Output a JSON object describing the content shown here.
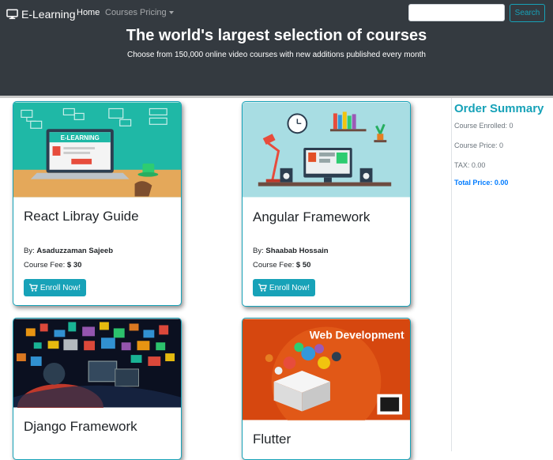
{
  "nav": {
    "brand": "E-Learning",
    "links": [
      "Home",
      "Courses",
      "Pricing"
    ],
    "search_button": "Search",
    "search_value": ""
  },
  "hero": {
    "title": "The world's largest selection of courses",
    "subtitle": "Choose from 150,000 online video courses with new additions published every month"
  },
  "courses": [
    {
      "title": "React Libray Guide",
      "author_label": "By:",
      "author": "Asaduzzaman Sajeeb",
      "fee_label": "Course Fee:",
      "fee": "$ 30",
      "button": "Enroll Now!",
      "image_text": "E-LEARNING"
    },
    {
      "title": "Angular Framework",
      "author_label": "By:",
      "author": "Shaabab Hossain",
      "fee_label": "Course Fee:",
      "fee": "$ 50",
      "button": "Enroll Now!"
    },
    {
      "title": "Django Framework"
    },
    {
      "title": "Flutter",
      "image_text": "Web Development"
    }
  ],
  "summary": {
    "title": "Order Summary",
    "enrolled": "Course Enrolled: 0",
    "price": "Course Price: 0",
    "tax": "TAX: 0.00",
    "total": "Total Price: 0.00"
  },
  "colors": {
    "nav_bg": "#343a40",
    "accent": "#17a2b8",
    "total": "#007bff"
  }
}
